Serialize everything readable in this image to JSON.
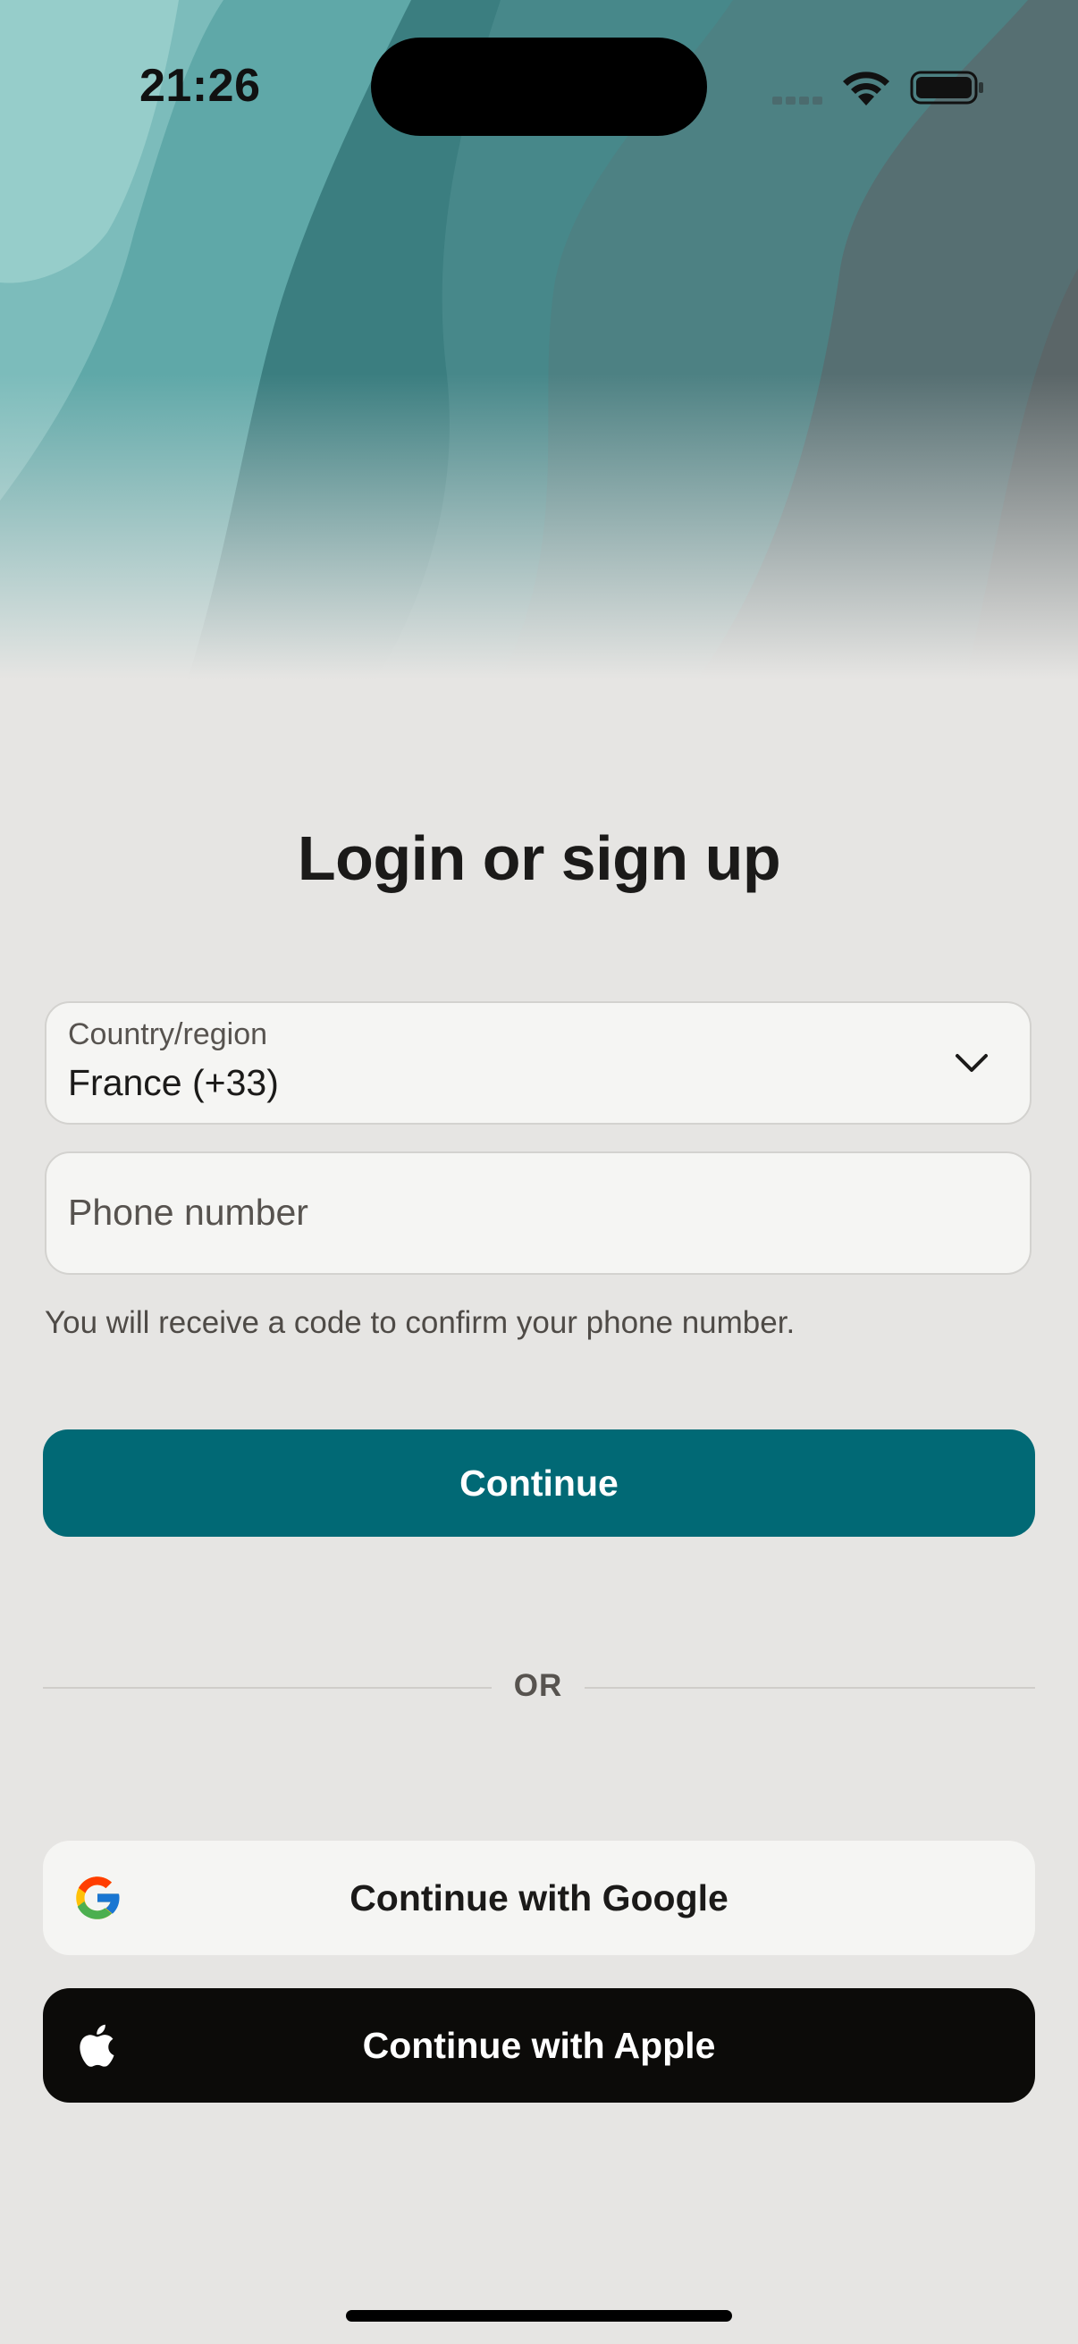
{
  "status_bar": {
    "time": "21:26"
  },
  "login": {
    "title": "Login or sign up",
    "country_field": {
      "label": "Country/region",
      "value": "France (+33)"
    },
    "phone_field": {
      "placeholder": "Phone number",
      "value": ""
    },
    "helper_text": "You will receive a code to confirm your phone number.",
    "continue_label": "Continue",
    "divider_label": "OR",
    "google_label": "Continue with Google",
    "apple_label": "Continue with Apple"
  },
  "colors": {
    "primary_button": "#016975",
    "page_background": "#e6e5e3",
    "apple_button": "#0c0b09",
    "field_background": "#f5f5f3"
  },
  "icons": [
    "wifi-icon",
    "battery-icon",
    "chevron-down-icon",
    "google-logo-icon",
    "apple-logo-icon"
  ]
}
